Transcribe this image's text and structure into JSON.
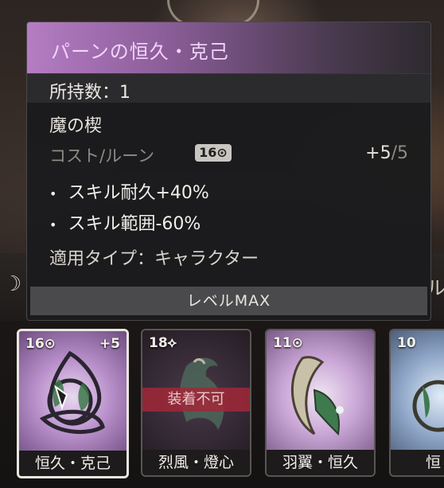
{
  "tooltip": {
    "title": "パーンの恒久・克己",
    "owned": "所持数：1",
    "category": "魔の楔",
    "cost_label": "コスト/ルーン",
    "cost_badge": "16⊙",
    "cost_current": "+5",
    "cost_max": "/5",
    "effects": [
      "スキル耐久+40%",
      "スキル範囲-60%"
    ],
    "apply_type": "適用タイプ：キャラクター",
    "level": "レベルMAX"
  },
  "cards": [
    {
      "cost": "16⊙",
      "plus": "+5",
      "name": "恒久・克己",
      "selected": true
    },
    {
      "cost": "18⟡",
      "plus": "",
      "name": "烈風・燈心",
      "lock": "装着不可"
    },
    {
      "cost": "11⊙",
      "plus": "",
      "name": "羽翼・恒久"
    },
    {
      "cost": "10",
      "plus": "",
      "name": "恒"
    }
  ],
  "background": {
    "left_glyph": "☽",
    "right_glyph": "ル"
  },
  "colors": {
    "title": "#f2d4fb",
    "header_accent": "#b57dc3",
    "lock": "#a02837"
  }
}
